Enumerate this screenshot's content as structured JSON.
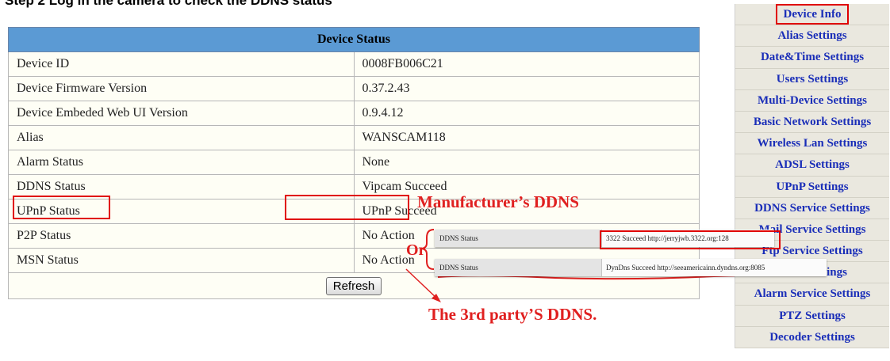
{
  "heading": "Step 2 Log in the camera to check the DDNS status",
  "table": {
    "header": "Device Status",
    "rows": [
      {
        "label": "Device ID",
        "value": "0008FB006C21"
      },
      {
        "label": "Device Firmware Version",
        "value": "0.37.2.43"
      },
      {
        "label": "Device Embeded Web UI Version",
        "value": "0.9.4.12"
      },
      {
        "label": "Alias",
        "value": "WANSCAM118"
      },
      {
        "label": "Alarm Status",
        "value": "None"
      },
      {
        "label": "DDNS Status",
        "value": "Vipcam Succeed"
      },
      {
        "label": "UPnP Status",
        "value": "UPnP Succeed"
      },
      {
        "label": "P2P Status",
        "value": "No Action"
      },
      {
        "label": "MSN Status",
        "value": "No Action"
      }
    ],
    "refresh_label": "Refresh"
  },
  "annotations": {
    "manufacturer": "Manufacturer’s DDNS",
    "or": "Or",
    "third_party": "The 3rd party’S DDNS.",
    "color": "#e02020"
  },
  "insets": [
    {
      "label": "DDNS Status",
      "value": "3322 Succeed  http://jerryjwb.3322.org:128"
    },
    {
      "label": "DDNS Status",
      "value": "DynDns Succeed  http://seeamericainn.dyndns.org:8085"
    }
  ],
  "nav": {
    "active_index": 0,
    "items": [
      "Device Info",
      "Alias Settings",
      "Date&Time Settings",
      "Users Settings",
      "Multi-Device Settings",
      "Basic Network Settings",
      "Wireless Lan Settings",
      "ADSL Settings",
      "UPnP Settings",
      "DDNS Service Settings",
      "Mail Service Settings",
      "Ftp Service Settings",
      "MSN Settings",
      "Alarm Service Settings",
      "PTZ Settings",
      "Decoder Settings"
    ]
  },
  "colors": {
    "header_bg": "#5b9ad4",
    "row_bg": "#fefef5",
    "nav_bg": "#eae8df",
    "nav_link": "#1a2eb8",
    "highlight": "#e00000"
  }
}
